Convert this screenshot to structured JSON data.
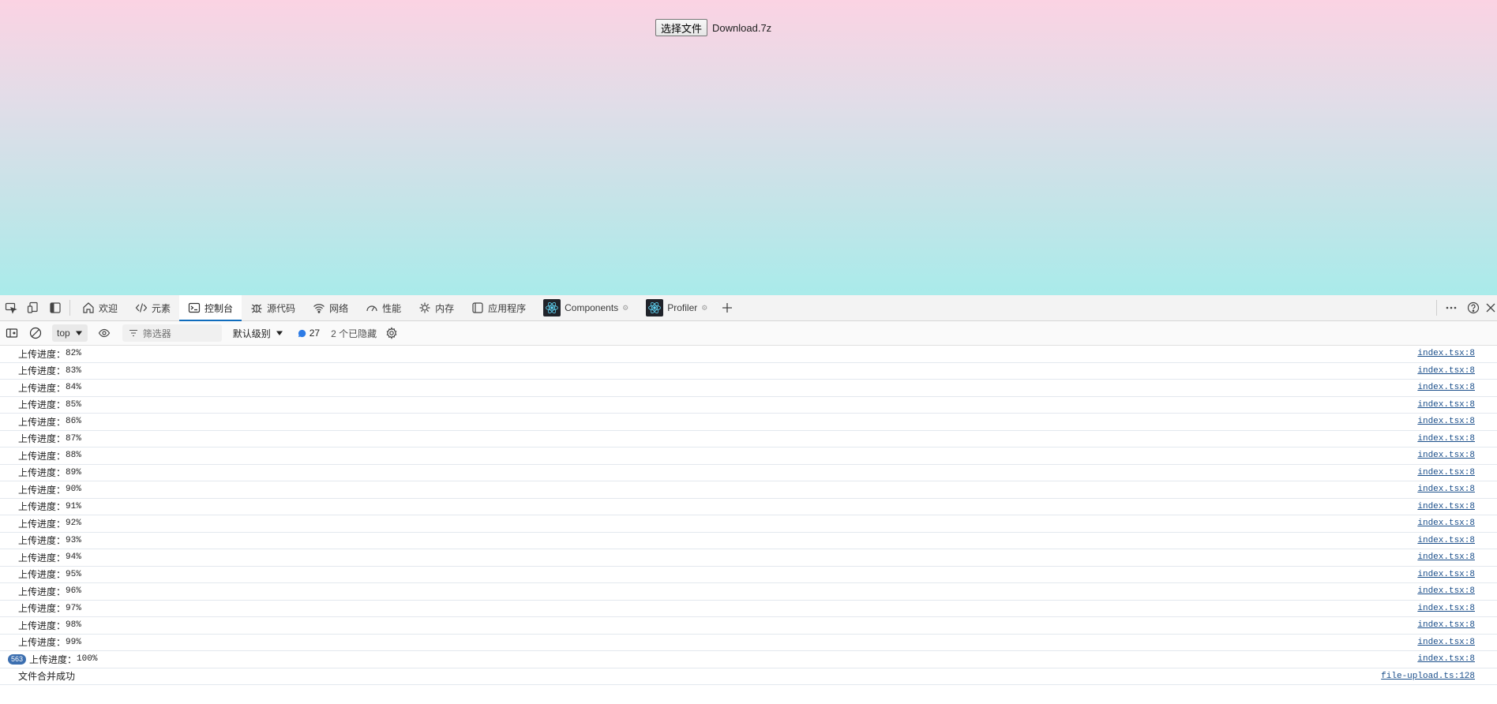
{
  "page": {
    "file_button": "选择文件",
    "file_name": "Download.7z"
  },
  "tabs": [
    {
      "label": "欢迎",
      "icon": "home-icon"
    },
    {
      "label": "元素",
      "icon": "code-icon"
    },
    {
      "label": "控制台",
      "icon": "console-icon",
      "active": true
    },
    {
      "label": "源代码",
      "icon": "bug-icon"
    },
    {
      "label": "网络",
      "icon": "wifi-icon"
    },
    {
      "label": "性能",
      "icon": "gauge-icon"
    },
    {
      "label": "内存",
      "icon": "memory-icon"
    },
    {
      "label": "应用程序",
      "icon": "app-icon"
    },
    {
      "label": "Components",
      "icon": "react-icon"
    },
    {
      "label": "Profiler",
      "icon": "react-icon"
    }
  ],
  "toolbar": {
    "context": "top",
    "filter_placeholder": "筛选器",
    "levels": "默认级别",
    "message_count": "27",
    "hidden": "2 个已隐藏"
  },
  "console": {
    "rows": [
      {
        "label": "上传进度：",
        "value": "82%",
        "source": "index.tsx:8"
      },
      {
        "label": "上传进度：",
        "value": "83%",
        "source": "index.tsx:8"
      },
      {
        "label": "上传进度：",
        "value": "84%",
        "source": "index.tsx:8"
      },
      {
        "label": "上传进度：",
        "value": "85%",
        "source": "index.tsx:8"
      },
      {
        "label": "上传进度：",
        "value": "86%",
        "source": "index.tsx:8"
      },
      {
        "label": "上传进度：",
        "value": "87%",
        "source": "index.tsx:8"
      },
      {
        "label": "上传进度：",
        "value": "88%",
        "source": "index.tsx:8"
      },
      {
        "label": "上传进度：",
        "value": "89%",
        "source": "index.tsx:8"
      },
      {
        "label": "上传进度：",
        "value": "90%",
        "source": "index.tsx:8"
      },
      {
        "label": "上传进度：",
        "value": "91%",
        "source": "index.tsx:8"
      },
      {
        "label": "上传进度：",
        "value": "92%",
        "source": "index.tsx:8"
      },
      {
        "label": "上传进度：",
        "value": "93%",
        "source": "index.tsx:8"
      },
      {
        "label": "上传进度：",
        "value": "94%",
        "source": "index.tsx:8"
      },
      {
        "label": "上传进度：",
        "value": "95%",
        "source": "index.tsx:8"
      },
      {
        "label": "上传进度：",
        "value": "96%",
        "source": "index.tsx:8"
      },
      {
        "label": "上传进度：",
        "value": "97%",
        "source": "index.tsx:8"
      },
      {
        "label": "上传进度：",
        "value": "98%",
        "source": "index.tsx:8"
      },
      {
        "label": "上传进度：",
        "value": "99%",
        "source": "index.tsx:8"
      },
      {
        "badge": "563",
        "label": "上传进度：",
        "value": "100%",
        "source": "index.tsx:8"
      }
    ],
    "final_row": {
      "label": "文件合并成功",
      "source": "file-upload.ts:128"
    }
  }
}
